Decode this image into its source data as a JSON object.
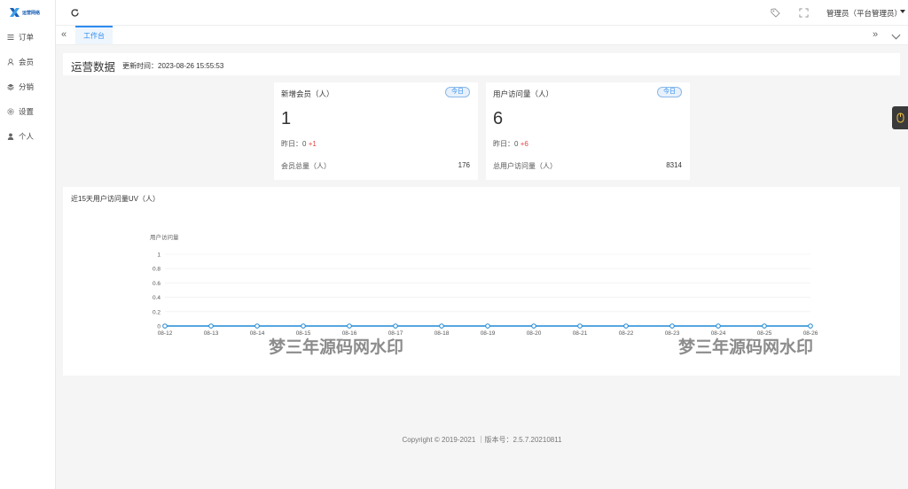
{
  "brand": {
    "logo_text": "运营网络"
  },
  "sidebar": {
    "items": [
      {
        "label": "订单",
        "icon": "list-icon"
      },
      {
        "label": "会员",
        "icon": "user-icon"
      },
      {
        "label": "分销",
        "icon": "layers-icon"
      },
      {
        "label": "设置",
        "icon": "gear-icon"
      },
      {
        "label": "个人",
        "icon": "person-icon"
      }
    ]
  },
  "header": {
    "user": "管理员（平台管理员）"
  },
  "tabs": {
    "active": "工作台"
  },
  "overview": {
    "title": "运营数据",
    "update_text": "更新时间：2023-08-26 15:55:53"
  },
  "cards": [
    {
      "title": "新增会员（人）",
      "badge": "今日",
      "value": "1",
      "yesterday_label": "昨日：",
      "yesterday_value": "0",
      "delta": "+1",
      "total_label": "会员总量（人）",
      "total_value": "176"
    },
    {
      "title": "用户访问量（人）",
      "badge": "今日",
      "value": "6",
      "yesterday_label": "昨日：",
      "yesterday_value": "0",
      "delta": "+6",
      "total_label": "总用户访问量（人）",
      "total_value": "8314"
    }
  ],
  "chart_data": {
    "type": "line",
    "title": "近15天用户访问量UV（人）",
    "ylabel": "用户访问量",
    "xlabel": "",
    "categories": [
      "08-12",
      "08-13",
      "08-14",
      "08-15",
      "08-16",
      "08-17",
      "08-18",
      "08-19",
      "08-20",
      "08-21",
      "08-22",
      "08-23",
      "08-24",
      "08-25",
      "08-26"
    ],
    "series": [
      {
        "values": [
          0,
          0,
          0,
          0,
          0,
          0,
          0,
          0,
          0,
          0,
          0,
          0,
          0,
          0,
          0
        ]
      }
    ],
    "yticks": [
      "0",
      "0.2",
      "0.4",
      "0.6",
      "0.8",
      "1"
    ],
    "ylim": [
      0,
      1
    ],
    "grid": true,
    "line_color": "#1f8ad6"
  },
  "watermark": {
    "text": "梦三年源码网水印"
  },
  "footer": {
    "text": "Copyright © 2019-2021 ｜版本号：2.5.7.20210811"
  }
}
